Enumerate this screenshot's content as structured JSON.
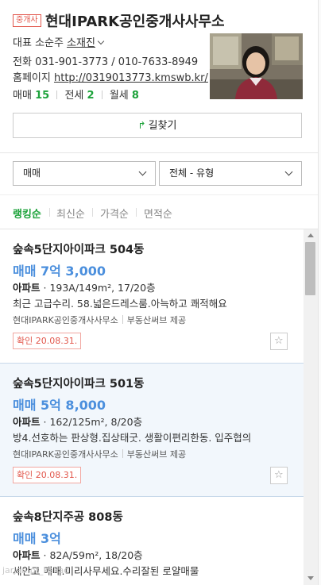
{
  "agent": {
    "badge": "중개사",
    "name": "현대IPARK공인중개사사무소",
    "rep_label": "대표",
    "rep_name": "소순주",
    "rep_extra": "소재진",
    "phone_label": "전화",
    "phone": "031-901-3773 / 010-7633-8949",
    "homepage_label": "홈페이지",
    "homepage": "http://0319013773.kmswb.kr/",
    "counts": [
      {
        "label": "매매",
        "value": "15"
      },
      {
        "label": "전세",
        "value": "2"
      },
      {
        "label": "월세",
        "value": "8"
      }
    ],
    "route_button": "길찾기"
  },
  "filters": {
    "trade_select": "매매",
    "type_select": "전체 - 유형"
  },
  "sort": {
    "options": [
      "랭킹순",
      "최신순",
      "가격순",
      "면적순"
    ],
    "active": "랭킹순"
  },
  "listings": [
    {
      "title": "숲속5단지아이파크 504동",
      "price": "매매 7억 3,000",
      "type": "아파트",
      "spec": "193A/149m², 17/20층",
      "desc": "최근 고급수리. 58.넓은드레스룸.아늑하고 쾌적해요",
      "agency": "현대IPARK공인중개사사무소",
      "provider": "부동산써브 제공",
      "confirmed": "확인 20.08.31."
    },
    {
      "title": "숲속5단지아이파크 501동",
      "price": "매매 5억 8,000",
      "type": "아파트",
      "spec": "162/125m², 8/20층",
      "desc": "방4.선호하는 판상형.집상태굿. 생활이편리한동. 입주협의",
      "agency": "현대IPARK공인중개사사무소",
      "provider": "부동산써브 제공",
      "confirmed": "확인 20.08.31."
    },
    {
      "title": "숲속8단지주공 808동",
      "price": "매매 3억",
      "type": "아파트",
      "spec": "82A/59m², 18/20층",
      "desc": "세안고 매매.미리사무세요.수리잘된 로얄매물"
    }
  ],
  "watermark": "jarjan.pt_kakao"
}
